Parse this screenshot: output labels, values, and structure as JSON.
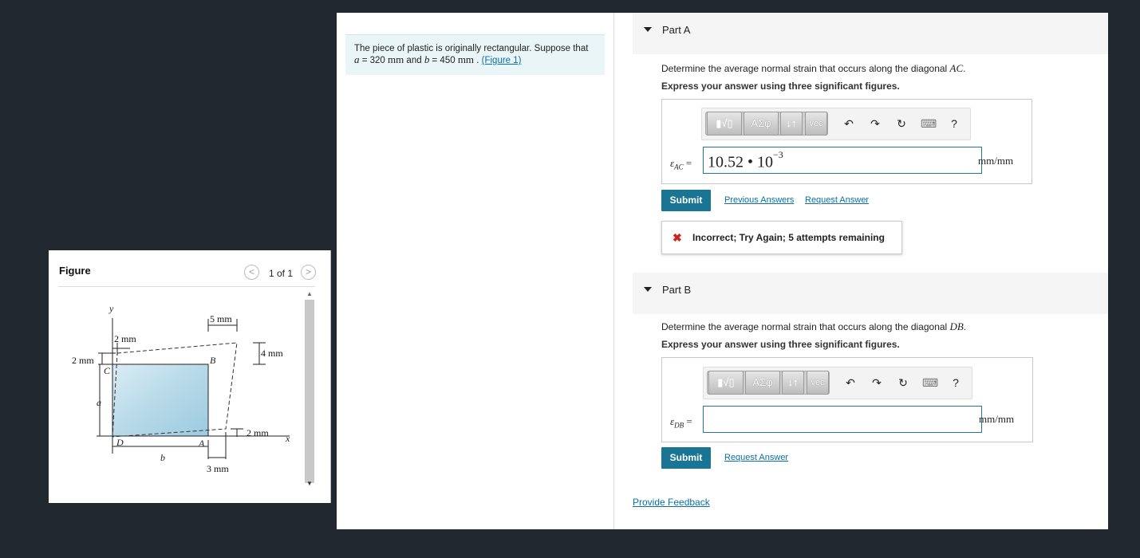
{
  "figure": {
    "title": "Figure",
    "pager": "1 of 1",
    "prev_icon": "chevron-left-icon",
    "next_icon": "chevron-right-icon",
    "labels": {
      "y": "y",
      "x": "x",
      "five_mm": "5 mm",
      "two_mm_top": "2 mm",
      "four_mm": "4 mm",
      "two_mm_left": "2 mm",
      "two_mm_right": "2 mm",
      "three_mm": "3 mm",
      "a": "a",
      "b": "b",
      "A": "A",
      "B": "B",
      "C": "C",
      "D": "D"
    }
  },
  "problem": {
    "text_start": "The piece of plastic is originally rectangular. Suppose that",
    "a_var": "a",
    "a_eq": " = 320 ",
    "a_unit": "mm",
    "and": " and ",
    "b_var": "b",
    "b_eq": " = 450 ",
    "b_unit": "mm",
    "after": " . ",
    "figure_link": "(Figure 1)"
  },
  "partA": {
    "label": "Part A",
    "question_prefix": "Determine the average normal strain that occurs along the diagonal ",
    "question_var": "AC",
    "question_suffix": ".",
    "instruction": "Express your answer using three significant figures.",
    "symbol": "ε",
    "subscript": "AC",
    "equals": " =",
    "answer_mantissa": "10.52 • 10",
    "answer_exponent": "−3",
    "unit": "mm/mm",
    "submit": "Submit",
    "previous_answers": "Previous Answers",
    "request_answer": "Request Answer",
    "feedback_icon": "✖",
    "feedback": "Incorrect; Try Again; 5 attempts remaining"
  },
  "partB": {
    "label": "Part B",
    "question_prefix": "Determine the average normal strain that occurs along the diagonal ",
    "question_var": "DB",
    "question_suffix": ".",
    "instruction": "Express your answer using three significant figures.",
    "symbol": "ε",
    "subscript": "DB",
    "equals": " =",
    "answer_value": "",
    "unit": "mm/mm",
    "submit": "Submit",
    "request_answer": "Request Answer"
  },
  "toolbar": {
    "templates": "▮√▯",
    "greek": "ΑΣφ",
    "arrows": "↓↑",
    "vec": "vec",
    "undo": "↶",
    "redo": "↷",
    "reset": "↻",
    "keyboard": "⌨",
    "help": "?"
  },
  "footer": {
    "provide_feedback": "Provide Feedback"
  },
  "colors": {
    "submit": "#1a7594",
    "link": "#0a6fa8",
    "error": "#d21f1f",
    "problem_bg": "#e9f5f7",
    "page_bg": "#212830"
  }
}
